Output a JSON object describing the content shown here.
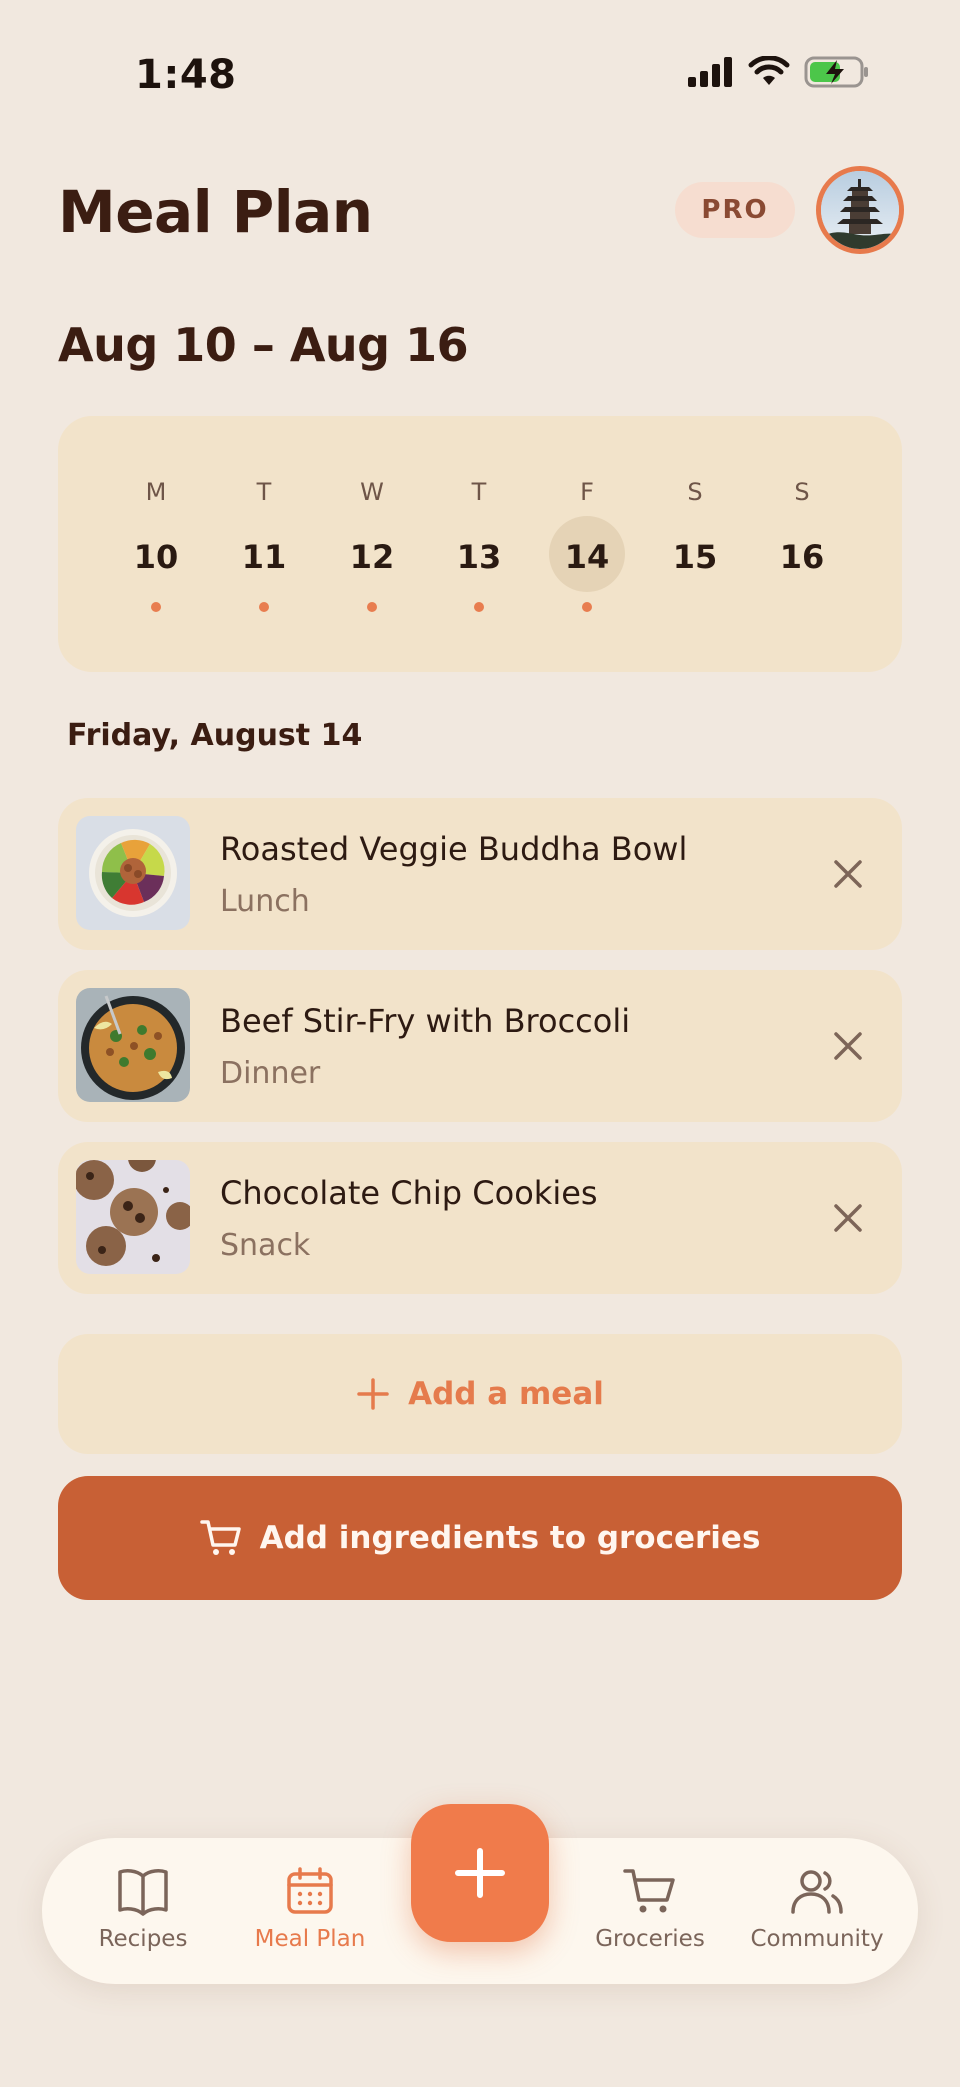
{
  "status_bar": {
    "time": "1:48"
  },
  "header": {
    "title": "Meal Plan",
    "badge": "PRO"
  },
  "week": {
    "range": "Aug 10 – Aug 16",
    "days": [
      {
        "letter": "M",
        "date": "10",
        "has_meals": true,
        "selected": false
      },
      {
        "letter": "T",
        "date": "11",
        "has_meals": true,
        "selected": false
      },
      {
        "letter": "W",
        "date": "12",
        "has_meals": true,
        "selected": false
      },
      {
        "letter": "T",
        "date": "13",
        "has_meals": true,
        "selected": false
      },
      {
        "letter": "F",
        "date": "14",
        "has_meals": true,
        "selected": true
      },
      {
        "letter": "S",
        "date": "15",
        "has_meals": false,
        "selected": false
      },
      {
        "letter": "S",
        "date": "16",
        "has_meals": false,
        "selected": false
      }
    ]
  },
  "selected_day": {
    "heading": "Friday, August 14"
  },
  "meals": [
    {
      "name": "Roasted Veggie Buddha Bowl",
      "type": "Lunch",
      "thumb_icon": "buddha-bowl-photo"
    },
    {
      "name": "Beef Stir-Fry with Broccoli",
      "type": "Dinner",
      "thumb_icon": "stir-fry-photo"
    },
    {
      "name": "Chocolate Chip Cookies",
      "type": "Snack",
      "thumb_icon": "cookies-photo"
    }
  ],
  "actions": {
    "add_meal": "Add a meal",
    "add_groceries": "Add ingredients to groceries"
  },
  "nav": {
    "items": [
      {
        "label": "Recipes",
        "icon": "book-icon",
        "active": false
      },
      {
        "label": "Meal Plan",
        "icon": "calendar-icon",
        "active": true
      },
      {
        "label": "Groceries",
        "icon": "cart-icon",
        "active": false
      },
      {
        "label": "Community",
        "icon": "people-icon",
        "active": false
      }
    ],
    "fab_icon": "plus-icon"
  },
  "colors": {
    "background": "#f1e8df",
    "card": "#f2e3ca",
    "accent": "#e77a4c",
    "primary_button": "#c86035",
    "title_text": "#3b1d12"
  }
}
